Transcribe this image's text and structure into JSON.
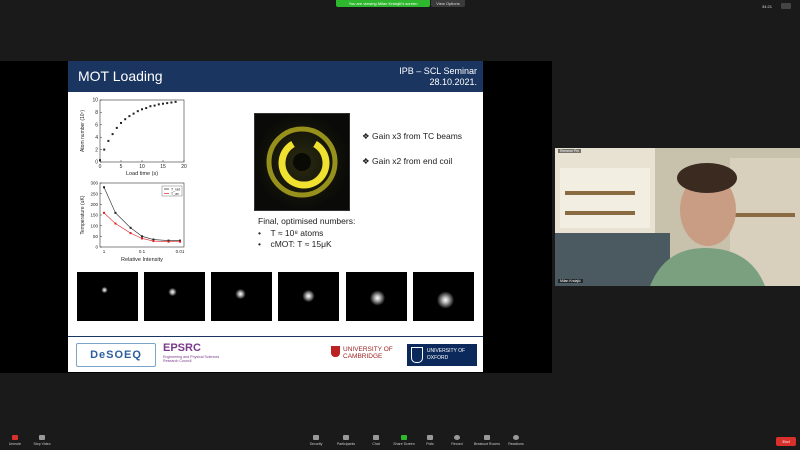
{
  "topbar": {
    "viewing_label": "You are viewing Milan Krstajić's screen",
    "view_options_label": "View Options",
    "clock": "34:21"
  },
  "slide": {
    "title": "MOT Loading",
    "header_right_line1": "IPB – SCL Seminar",
    "header_right_line2": "28.10.2021.",
    "bullets": [
      "Gain x3 from TC beams",
      "Gain x2 from end coil"
    ],
    "final_heading": "Final, optimised numbers:",
    "final_items": [
      "T ≈ 10⁸ atoms",
      "cMOT: T ≈ 15μK"
    ],
    "footer": {
      "desoeq": "DeSOEQ",
      "epsrc": "EPSRC",
      "epsrc_sub": "Engineering and Physical Sciences Research Council",
      "cambridge": "UNIVERSITY OF CAMBRIDGE",
      "oxford": "UNIVERSITY OF OXFORD"
    }
  },
  "chart_data": [
    {
      "type": "scatter",
      "xlabel": "Load time (s)",
      "ylabel": "Atom number (10⁷)",
      "xlim": [
        0,
        20
      ],
      "ylim": [
        0,
        10
      ],
      "xticks": [
        0,
        5,
        10,
        15,
        20
      ],
      "yticks": [
        0,
        2,
        4,
        6,
        8,
        10
      ],
      "x": [
        0,
        1,
        2,
        3,
        4,
        5,
        6,
        7,
        8,
        9,
        10,
        11,
        12,
        13,
        14,
        15,
        16,
        17,
        18
      ],
      "y": [
        0.3,
        2.0,
        3.4,
        4.5,
        5.5,
        6.3,
        6.9,
        7.4,
        7.8,
        8.2,
        8.5,
        8.7,
        9.0,
        9.1,
        9.3,
        9.4,
        9.5,
        9.6,
        9.7
      ]
    },
    {
      "type": "line",
      "xlabel": "Relative Intensity",
      "ylabel": "Temperature (uK)",
      "ylim": [
        0,
        300
      ],
      "yticks": [
        0,
        50,
        100,
        150,
        200,
        250,
        300
      ],
      "xticks": [
        "1",
        "0.1",
        "0.01"
      ],
      "legend": "top-right",
      "series": [
        {
          "name": "T_rad",
          "color": "#222222",
          "x": [
            1,
            0.5,
            0.2,
            0.1,
            0.05,
            0.02,
            0.01
          ],
          "y": [
            280,
            160,
            90,
            50,
            35,
            30,
            30
          ]
        },
        {
          "name": "T_ax",
          "color": "#e02020",
          "x": [
            1,
            0.5,
            0.2,
            0.1,
            0.05,
            0.02,
            0.01
          ],
          "y": [
            160,
            110,
            65,
            40,
            28,
            25,
            25
          ]
        }
      ]
    }
  ],
  "thumbnails": [
    {
      "size": 0.15
    },
    {
      "size": 0.25
    },
    {
      "size": 0.35
    },
    {
      "size": 0.45
    },
    {
      "size": 0.55
    },
    {
      "size": 0.65
    }
  ],
  "webcam": {
    "label": "Remove Pin",
    "name": "Milan Krstajić"
  },
  "toolbar": {
    "items": [
      "Unmute",
      "Stop Video",
      "Security",
      "Participants",
      "Chat",
      "Share Screen",
      "Polls",
      "Record",
      "Breakout Rooms",
      "Reactions"
    ],
    "participants_count": "31",
    "end_label": "End"
  }
}
